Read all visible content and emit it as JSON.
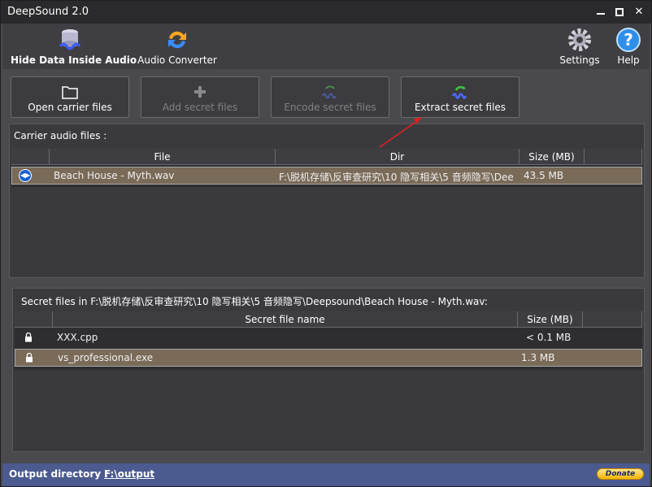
{
  "window": {
    "title": "DeepSound 2.0"
  },
  "toolbar": {
    "hide_data_label": "Hide Data Inside Audio",
    "audio_converter_label": "Audio Converter",
    "settings_label": "Settings",
    "help_label": "Help"
  },
  "actions": {
    "open_carrier": "Open carrier files",
    "add_secret": "Add secret files",
    "encode_secret": "Encode secret files",
    "extract_secret": "Extract secret files"
  },
  "carrier": {
    "title": "Carrier audio files :",
    "columns": [
      "File",
      "Dir",
      "Size (MB)"
    ],
    "rows": [
      {
        "file": "Beach House - Myth.wav",
        "dir": "F:\\脱机存储\\反审查研究\\10 隐写相关\\5 音频隐写\\Dee",
        "size": "43.5 MB"
      }
    ]
  },
  "secret": {
    "title": "Secret files in F:\\脱机存储\\反审查研究\\10 隐写相关\\5 音频隐写\\Deepsound\\Beach House - Myth.wav:",
    "columns": [
      "Secret file name",
      "Size (MB)"
    ],
    "rows": [
      {
        "name": "XXX.cpp",
        "size": "< 0.1 MB"
      },
      {
        "name": "vs_professional.exe",
        "size": "1.3 MB"
      }
    ]
  },
  "status": {
    "output_label": "Output directory :",
    "output_path": "F:\\output",
    "donate_label": "Donate"
  },
  "colors": {
    "window_bg": "#4a4a4e",
    "selection": "#7a6a58",
    "status_bar": "#4b5a8f",
    "arrow": "#e02020"
  }
}
